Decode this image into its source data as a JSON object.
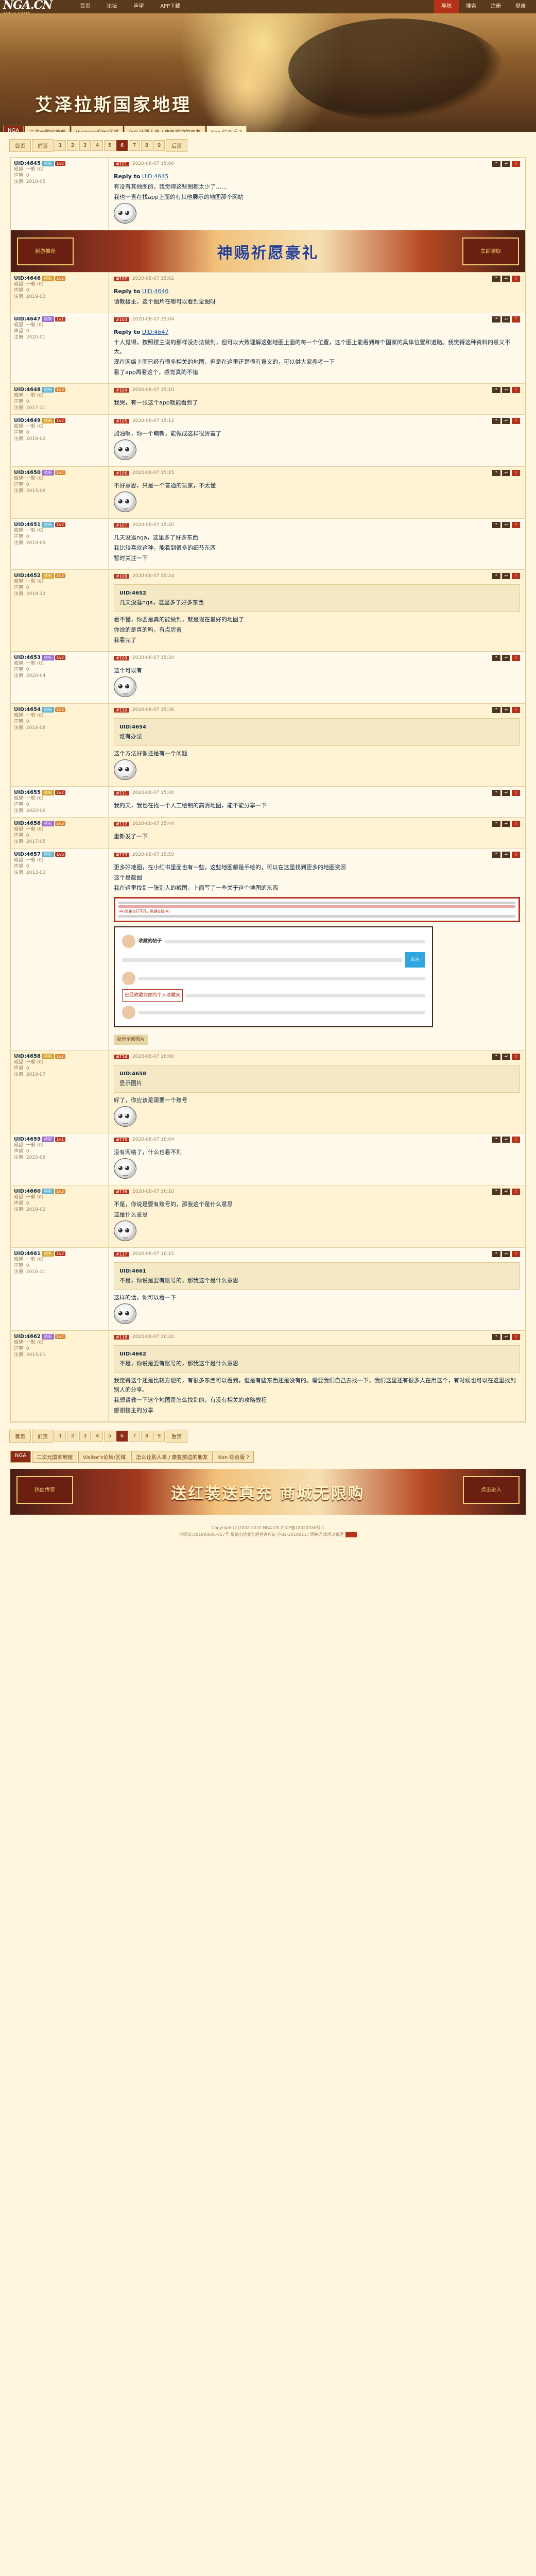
{
  "topbar": {
    "logo": "NGA.CN",
    "logo_sub": "ACG & GAME",
    "nav": [
      "首页",
      "论坛",
      "声望",
      "APP下载"
    ],
    "right": [
      "导航",
      "搜索",
      "注册",
      "登录"
    ]
  },
  "banner": {
    "title": "艾泽拉斯国家地理",
    "breadcrumb": [
      "NGA",
      "二次元国家地理",
      "Visitor's论坛/区域",
      "怎么让别人来 / 康复那边的朋友",
      "Kon 综合版 ?"
    ]
  },
  "pager": {
    "first": "首页",
    "prev": "前页",
    "pages": [
      "1",
      "2",
      "3",
      "4",
      "5",
      "6",
      "7",
      "8",
      "9"
    ],
    "current": "6",
    "next": "后页"
  },
  "ad": {
    "main": "神赐祈愿豪礼",
    "left": "新游推荐",
    "right": "立即领取"
  },
  "ad_bottom": {
    "main": "送红装送真充 商城无限购",
    "left": "热血传奇",
    "right": "点击进入"
  },
  "posts": [
    {
      "floor": "#101",
      "user": "UID:4645",
      "tag": "萌新",
      "level": "Lv2",
      "stats": [
        "威望: 一般 (0)",
        "声望: 0",
        "注册: 2018-05"
      ],
      "time": "2020-08-07 15:00",
      "reply_to": "Reply to",
      "lines": [
        "有没有其他图的，我觉得这些图都太少了……",
        "我也一直在找app上面的有其他展示的地图那个网站"
      ],
      "emoji": true
    },
    {
      "floor": "#102",
      "user": "UID:4646",
      "tag": "萌新",
      "level": "Lv2",
      "stats": [
        "威望: 一般 (0)",
        "声望: 0",
        "注册: 2019-03"
      ],
      "time": "2020-08-07 15:02",
      "reply_to": "Reply to",
      "lines": [
        "请教楼主，这个图片在哪可以看到全图呀"
      ]
    },
    {
      "floor": "#103",
      "user": "UID:4647",
      "tag": "萌新",
      "level": "Lv1",
      "stats": [
        "威望: 一般 (0)",
        "声望: 0",
        "注册: 2020-01"
      ],
      "time": "2020-08-07 15:04",
      "reply_to": "Reply to",
      "lines": [
        "个人觉得，按照楼主说的那样没办法做到，但可以大致理解这张地图上面的每一个位置，这个图上能看到每个国家的具体位置和道路。我觉得这种资料的意义不大。",
        "现在网络上面已经有很多相关的地图，但是在这里还是很有意义的，可以供大家参考一下",
        "看了app再看这个，感觉真的不错"
      ]
    },
    {
      "floor": "#104",
      "user": "UID:4648",
      "tag": "萌新",
      "level": "Lv3",
      "stats": [
        "威望: 一般 (0)",
        "声望: 0",
        "注册: 2017-11"
      ],
      "time": "2020-08-07 15:10",
      "lines": [
        "我哭，有一张这个app就能看到了"
      ]
    },
    {
      "floor": "#105",
      "user": "UID:4649",
      "tag": "萌新",
      "level": "Lv2",
      "stats": [
        "威望: 一般 (0)",
        "声望: 0",
        "注册: 2016-02"
      ],
      "time": "2020-08-07 15:12",
      "lines": [
        "加油啊，你一个萌新，能做成这样很厉害了"
      ],
      "emoji": true
    },
    {
      "floor": "#106",
      "user": "UID:4650",
      "tag": "萌新",
      "level": "Lv4",
      "stats": [
        "威望: 一般 (0)",
        "声望: 0",
        "注册: 2015-06"
      ],
      "time": "2020-08-07 15:15",
      "lines": [
        "不好意思，只是一个普通的玩家，不太懂"
      ],
      "emoji": true
    },
    {
      "floor": "#107",
      "user": "UID:4651",
      "tag": "萌新",
      "level": "Lv2",
      "stats": [
        "威望: 一般 (0)",
        "声望: 0",
        "注册: 2019-09"
      ],
      "time": "2020-08-07 15:20",
      "lines": [
        "几天没逛nga，这里多了好多东西",
        "我比较喜欢这种，能看到很多的细节东西",
        "暂时关注一下"
      ]
    },
    {
      "floor": "#108",
      "user": "UID:4652",
      "tag": "萌新",
      "level": "Lv3",
      "stats": [
        "威望: 一般 (0)",
        "声望: 0",
        "注册: 2018-12"
      ],
      "time": "2020-08-07 15:24",
      "quote": "几天没逛nga，这里多了好多东西",
      "lines": [
        "看不懂，你要是真的能做到，就是现在最好的地图了",
        "你说的是真的吗，有点厉害",
        "我看完了"
      ]
    },
    {
      "floor": "#109",
      "user": "UID:4653",
      "tag": "萌新",
      "level": "Lv2",
      "stats": [
        "威望: 一般 (0)",
        "声望: 0",
        "注册: 2020-04"
      ],
      "time": "2020-08-07 15:30",
      "lines": [
        "这个可以有"
      ],
      "emoji": true
    },
    {
      "floor": "#110",
      "user": "UID:4654",
      "tag": "萌新",
      "level": "Lv5",
      "stats": [
        "威望: 一般 (0)",
        "声望: 0",
        "注册: 2014-08"
      ],
      "time": "2020-08-07 15:36",
      "quote": "谁有办法",
      "lines": [
        "这个方法好像还是有一个问题"
      ],
      "emoji": true
    },
    {
      "floor": "#111",
      "user": "UID:4655",
      "tag": "萌新",
      "level": "Lv2",
      "stats": [
        "威望: 一般 (0)",
        "声望: 0",
        "注册: 2020-06"
      ],
      "time": "2020-08-07 15:40",
      "lines": [
        "我的天，我也在找一个人工绘制的高清地图，能不能分享一下"
      ]
    },
    {
      "floor": "#112",
      "user": "UID:4656",
      "tag": "萌新",
      "level": "Lv3",
      "stats": [
        "威望: 一般 (0)",
        "声望: 0",
        "注册: 2017-05"
      ],
      "time": "2020-08-07 15:44",
      "lines": [
        "重新发了一下"
      ]
    },
    {
      "floor": "#113",
      "user": "UID:4657",
      "tag": "萌新",
      "level": "Lv6",
      "stats": [
        "威望: 一般 (0)",
        "声望: 0",
        "注册: 2013-02"
      ],
      "time": "2020-08-07 15:50",
      "lines": [
        "更多好地图，在小红书里面也有一些，这些地图都是手绘的，可以在这里找到更多的地图资源",
        "这个是截图",
        "我在这里找到一张别人的截图，上面写了一些关于这个地图的东西"
      ],
      "highlight": "(4G流量也打不开，数据在缓冲)",
      "screenshot": {
        "title": "收藏的帖子",
        "button": "关注",
        "note": "已经收藏到你的个人收藏夹"
      },
      "footer_tag": "显示全部图片"
    },
    {
      "floor": "#114",
      "user": "UID:4658",
      "tag": "萌新",
      "level": "Lv2",
      "stats": [
        "威望: 一般 (0)",
        "声望: 0",
        "注册: 2019-07"
      ],
      "time": "2020-08-07 16:00",
      "quote": "显示图片",
      "lines": [
        "好了，你应该是需要一个账号"
      ],
      "emoji": true
    },
    {
      "floor": "#115",
      "user": "UID:4659",
      "tag": "萌新",
      "level": "Lv1",
      "stats": [
        "威望: 一般 (0)",
        "声望: 0",
        "注册: 2020-08"
      ],
      "time": "2020-08-07 16:04",
      "lines": [
        "没有网络了，什么也看不到"
      ],
      "emoji": true
    },
    {
      "floor": "#116",
      "user": "UID:4660",
      "tag": "萌新",
      "level": "Lv3",
      "stats": [
        "威望: 一般 (0)",
        "声望: 0",
        "注册: 2018-02"
      ],
      "time": "2020-08-07 16:10",
      "lines": [
        "不是，你说是要有账号的，那我这个是什么意思",
        "这是什么意思"
      ],
      "emoji": true
    },
    {
      "floor": "#117",
      "user": "UID:4661",
      "tag": "萌新",
      "level": "Lv2",
      "stats": [
        "威望: 一般 (0)",
        "声望: 0",
        "注册: 2016-11"
      ],
      "time": "2020-08-07 16:15",
      "quote": "不是，你说是要有账号的，那我这个是什么意思",
      "lines": [
        "这样的话，你可以看一下"
      ],
      "emoji": true
    },
    {
      "floor": "#118",
      "user": "UID:4662",
      "tag": "萌新",
      "level": "Lv4",
      "stats": [
        "威望: 一般 (0)",
        "声望: 0",
        "注册: 2015-01"
      ],
      "time": "2020-08-07 16:20",
      "quote": "不是，你说是要有账号的，那我这个是什么意思",
      "lines": [
        "我觉得这个还是比较方便的，有很多东西可以看到，但是有些东西还是没有的。需要我们自己去找一下，我们这里还有很多人在用这个，有时候也可以在这里找到别人的分享。",
        "我想请教一下这个地图是怎么找到的，有没有相关的攻略教程",
        "感谢楼主的分享"
      ]
    }
  ],
  "footer": {
    "tags": [
      "NGA",
      "二次元国家地理",
      "Visitor's论坛/区域",
      "怎么让别人来 / 康复那边的朋友",
      "Kon 综合版 ?"
    ],
    "lines": [
      "Copyright (C)2002-2020 NGA.CN   沪ICP备18020326号-1",
      "沪网文[2019]0806-057号   增值电信业务经营许可证 沪B2-20180117   网络游戏活动管理"
    ]
  }
}
